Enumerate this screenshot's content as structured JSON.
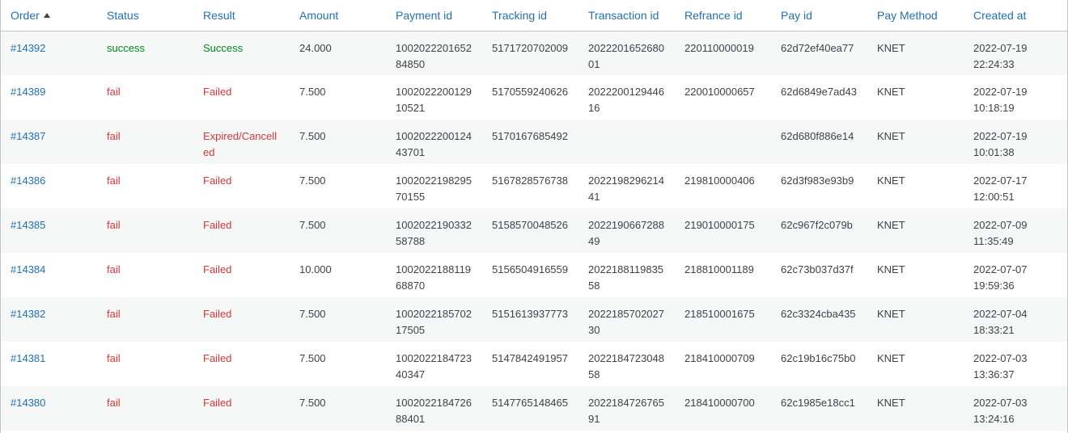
{
  "table": {
    "columns": [
      "Order",
      "Status",
      "Result",
      "Amount",
      "Payment id",
      "Tracking id",
      "Transaction id",
      "Refrance id",
      "Pay id",
      "Pay Method",
      "Created at"
    ],
    "sort_indicator": "ascending",
    "rows": [
      {
        "order": "#14392",
        "status": "success",
        "result": "Success",
        "amount": "24.000",
        "payment_id": "100202220165284850",
        "tracking_id": "5171720702009",
        "transaction_id": "202220165268001",
        "refrance_id": "220110000019",
        "pay_id": "62d72ef40ea77",
        "pay_method": "KNET",
        "created_at": "2022-07-19\n22:24:33",
        "ok": true
      },
      {
        "order": "#14389",
        "status": "fail",
        "result": "Failed",
        "amount": "7.500",
        "payment_id": "100202220012910521",
        "tracking_id": "5170559240626",
        "transaction_id": "202220012944616",
        "refrance_id": "220010000657",
        "pay_id": "62d6849e7ad43",
        "pay_method": "KNET",
        "created_at": "2022-07-19\n10:18:19",
        "ok": false
      },
      {
        "order": "#14387",
        "status": "fail",
        "result": "Expired/Cancelled",
        "amount": "7.500",
        "payment_id": "100202220012443701",
        "tracking_id": "5170167685492",
        "transaction_id": "",
        "refrance_id": "",
        "pay_id": "62d680f886e14",
        "pay_method": "KNET",
        "created_at": "2022-07-19\n10:01:38",
        "ok": false
      },
      {
        "order": "#14386",
        "status": "fail",
        "result": "Failed",
        "amount": "7.500",
        "payment_id": "100202219829570155",
        "tracking_id": "5167828576738",
        "transaction_id": "202219829621441",
        "refrance_id": "219810000406",
        "pay_id": "62d3f983e93b9",
        "pay_method": "KNET",
        "created_at": "2022-07-17\n12:00:51",
        "ok": false
      },
      {
        "order": "#14385",
        "status": "fail",
        "result": "Failed",
        "amount": "7.500",
        "payment_id": "100202219033258788",
        "tracking_id": "5158570048526",
        "transaction_id": "202219066728849",
        "refrance_id": "219010000175",
        "pay_id": "62c967f2c079b",
        "pay_method": "KNET",
        "created_at": "2022-07-09\n11:35:49",
        "ok": false
      },
      {
        "order": "#14384",
        "status": "fail",
        "result": "Failed",
        "amount": "10.000",
        "payment_id": "100202218811968870",
        "tracking_id": "5156504916559",
        "transaction_id": "202218811983558",
        "refrance_id": "218810001189",
        "pay_id": "62c73b037d37f",
        "pay_method": "KNET",
        "created_at": "2022-07-07\n19:59:36",
        "ok": false
      },
      {
        "order": "#14382",
        "status": "fail",
        "result": "Failed",
        "amount": "7.500",
        "payment_id": "100202218570217505",
        "tracking_id": "5151613937773",
        "transaction_id": "202218570202730",
        "refrance_id": "218510001675",
        "pay_id": "62c3324cba435",
        "pay_method": "KNET",
        "created_at": "2022-07-04\n18:33:21",
        "ok": false
      },
      {
        "order": "#14381",
        "status": "fail",
        "result": "Failed",
        "amount": "7.500",
        "payment_id": "100202218472340347",
        "tracking_id": "5147842491957",
        "transaction_id": "202218472304858",
        "refrance_id": "218410000709",
        "pay_id": "62c19b16c75b0",
        "pay_method": "KNET",
        "created_at": "2022-07-03\n13:36:37",
        "ok": false
      },
      {
        "order": "#14380",
        "status": "fail",
        "result": "Failed",
        "amount": "7.500",
        "payment_id": "100202218472688401",
        "tracking_id": "5147765148465",
        "transaction_id": "202218472676591",
        "refrance_id": "218410000700",
        "pay_id": "62c1985e18cc1",
        "pay_method": "KNET",
        "created_at": "2022-07-03\n13:24:16",
        "ok": false
      }
    ]
  },
  "colors": {
    "link": "#2271b1",
    "success": "#008a20",
    "fail": "#d63638",
    "stripe": "#f6f7f7"
  }
}
